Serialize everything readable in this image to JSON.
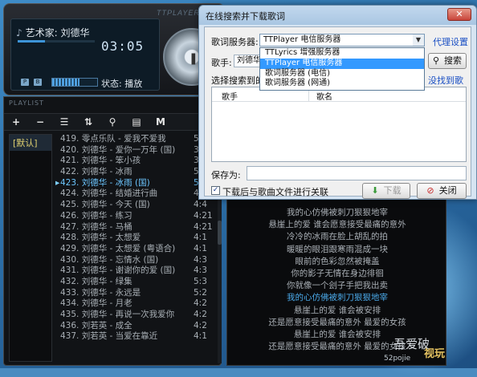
{
  "player": {
    "brand": "TTPLAYER",
    "artist_line": "艺术家: 刘德华",
    "time": "03:05",
    "seek_fraction": 0.35,
    "volume_fraction": 0.6,
    "status": "状态: 播放",
    "mini_p": "P",
    "mini_b": "B"
  },
  "playlist": {
    "title": "PLAYLIST",
    "toolbar": [
      "+",
      "−",
      "☰",
      "⇅",
      "⚲",
      "▤",
      "M"
    ],
    "group": "[默认]",
    "songs": [
      {
        "name": "419. 零点乐队 - 爱我不爱我",
        "dur": "5:0",
        "current": false
      },
      {
        "name": "420. 刘德华 - 爱你一万年 (国)",
        "dur": "3:5",
        "current": false
      },
      {
        "name": "421. 刘德华 - 笨小孩",
        "dur": "3:2",
        "current": false
      },
      {
        "name": "422. 刘德华 - 冰雨",
        "dur": "5:0",
        "current": false
      },
      {
        "name": "423. 刘德华 - 冰雨 (国)",
        "dur": "5:0",
        "current": true
      },
      {
        "name": "424. 刘德华 - 结婚进行曲",
        "dur": "4:4",
        "current": false
      },
      {
        "name": "425. 刘德华 - 今天 (国)",
        "dur": "4:4",
        "current": false
      },
      {
        "name": "426. 刘德华 - 练习",
        "dur": "4:21",
        "current": false
      },
      {
        "name": "427. 刘德华 - 马桶",
        "dur": "4:21",
        "current": false
      },
      {
        "name": "428. 刘德华 - 太想爱",
        "dur": "4:1",
        "current": false
      },
      {
        "name": "429. 刘德华 - 太想爱 (粤语合)",
        "dur": "4:1",
        "current": false
      },
      {
        "name": "430. 刘德华 - 忘情水 (国)",
        "dur": "4:3",
        "current": false
      },
      {
        "name": "431. 刘德华 - 谢谢你的爱 (国)",
        "dur": "4:3",
        "current": false
      },
      {
        "name": "432. 刘德华 - 绿集",
        "dur": "5:3",
        "current": false
      },
      {
        "name": "433. 刘德华 - 永远是",
        "dur": "5:2",
        "current": false
      },
      {
        "name": "434. 刘德华 - 月老",
        "dur": "4:2",
        "current": false
      },
      {
        "name": "435. 刘德华 - 再说一次我爱你",
        "dur": "4:2",
        "current": false
      },
      {
        "name": "436. 刘若英 - 成全",
        "dur": "4:2",
        "current": false
      },
      {
        "name": "437. 刘若英 - 当爱在靠近",
        "dur": "4:1",
        "current": false
      }
    ]
  },
  "lyrics": [
    {
      "text": "我的心仿佛被刺刀狠狠地宰",
      "hl": false
    },
    {
      "text": "悬崖上的爱 谁会愿意接受最痛的意外",
      "hl": false
    },
    {
      "text": "冷冷的冰雨在脸上胡乱的拍",
      "hl": false
    },
    {
      "text": "暖暖的眼泪跟寒雨混成一块",
      "hl": false
    },
    {
      "text": "眼前的色彩忽然被掩盖",
      "hl": false
    },
    {
      "text": "你的影子无情在身边徘徊",
      "hl": false
    },
    {
      "text": "你就像一个刽子手把我出卖",
      "hl": false
    },
    {
      "text": "我的心仿佛被刺刀狠狠地宰",
      "hl": true
    },
    {
      "text": "悬崖上的爱 谁会被安排",
      "hl": false
    },
    {
      "text": "还是愿意接受最痛的意外 最爱的女孩",
      "hl": false
    },
    {
      "text": "悬崖上的爱 谁会被安排",
      "hl": false
    },
    {
      "text": "还是愿意接受最痛的意外 最爱的女孩",
      "hl": false
    }
  ],
  "watermark": {
    "text1": "吾爱破",
    "text2": "52pojie",
    "text3": "视玩"
  },
  "dialog": {
    "title": "在线搜索并下载歌词",
    "close": "✕",
    "server_label": "歌词服务器:",
    "server_selected": "TTPlayer 电信服务器",
    "proxy_link": "代理设置",
    "artist_label": "歌手:",
    "artist_value": "刘德华",
    "search_btn": "搜索",
    "search_results_label": "选择搜索到的",
    "not_found_link": "没找到歌词",
    "dropdown_options": [
      {
        "text": "TTLyrics 增强服务器",
        "sel": false
      },
      {
        "text": "TTPlayer 电信服务器",
        "sel": true
      },
      {
        "text": "歌词服务器 (电信)",
        "sel": false
      },
      {
        "text": "歌词服务器 (网通)",
        "sel": false
      }
    ],
    "col_artist": "歌手",
    "col_title": "歌名",
    "saveas_label": "保存为:",
    "close_after_label": "下载后与歌曲文件进行关联",
    "download_btn": "下载",
    "close_btn": "关闭"
  }
}
